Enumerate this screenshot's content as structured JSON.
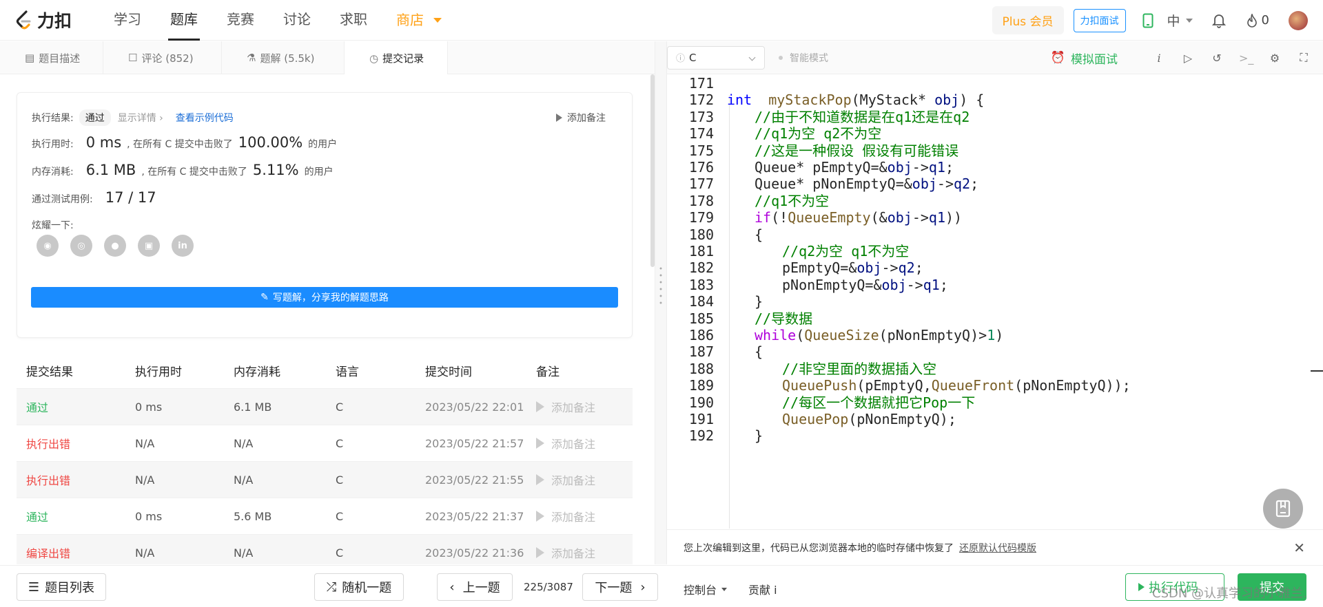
{
  "nav": {
    "brand": "力扣",
    "items": [
      "学习",
      "题库",
      "竞赛",
      "讨论",
      "求职",
      "商店"
    ],
    "active": "题库",
    "plus": "Plus 会员",
    "mock_interview": "力扣面试",
    "lang": "中",
    "points": "0"
  },
  "tabs": [
    "题目描述",
    "评论 (852)",
    "题解 (5.5k)",
    "提交记录"
  ],
  "result": {
    "label_result": "执行结果:",
    "status": "通过",
    "show_detail": "显示详情 ›",
    "view_example": "查看示例代码",
    "add_note": "添加备注",
    "label_time": "执行用时:",
    "time_value": "0 ms",
    "time_text": ", 在所有 C 提交中击败了",
    "time_pct": "100.00%",
    "users": "的用户",
    "label_mem": "内存消耗:",
    "mem_value": "6.1 MB",
    "mem_text": ", 在所有 C 提交中击败了",
    "mem_pct": "5.11%",
    "label_cases": "通过测试用例:",
    "cases": "17 / 17",
    "label_share": "炫耀一下:",
    "write_solution": "写题解，分享我的解题思路"
  },
  "table": {
    "headers": [
      "提交结果",
      "执行用时",
      "内存消耗",
      "语言",
      "提交时间",
      "备注"
    ],
    "rows": [
      {
        "status": "通过",
        "time": "0 ms",
        "mem": "6.1 MB",
        "lang": "C",
        "date": "2023/05/22 22:01",
        "note": "添加备注"
      },
      {
        "status": "执行出错",
        "time": "N/A",
        "mem": "N/A",
        "lang": "C",
        "date": "2023/05/22 21:57",
        "note": "添加备注"
      },
      {
        "status": "执行出错",
        "time": "N/A",
        "mem": "N/A",
        "lang": "C",
        "date": "2023/05/22 21:55",
        "note": "添加备注"
      },
      {
        "status": "通过",
        "time": "0 ms",
        "mem": "5.6 MB",
        "lang": "C",
        "date": "2023/05/22 21:37",
        "note": "添加备注"
      },
      {
        "status": "编译出错",
        "time": "N/A",
        "mem": "N/A",
        "lang": "C",
        "date": "2023/05/22 21:36",
        "note": "添加备注"
      }
    ]
  },
  "editor": {
    "language": "C",
    "smart_mode": "智能模式",
    "mock_interview": "模拟面试",
    "lines": [
      {
        "n": "171",
        "indent": 0,
        "parts": []
      },
      {
        "n": "172",
        "indent": 0,
        "parts": [
          [
            "kw",
            "int"
          ],
          [
            "",
            "  "
          ],
          [
            "fn",
            "myStackPop"
          ],
          [
            "",
            "(MyStack* "
          ],
          [
            "vr",
            "obj"
          ],
          [
            "",
            ") {"
          ]
        ]
      },
      {
        "n": "173",
        "indent": 1,
        "parts": [
          [
            "cm",
            "//由于不知道数据是在q1还是在q2"
          ]
        ]
      },
      {
        "n": "174",
        "indent": 1,
        "parts": [
          [
            "cm",
            "//q1为空 q2不为空"
          ]
        ]
      },
      {
        "n": "175",
        "indent": 1,
        "parts": [
          [
            "cm",
            "//这是一种假设 假设有可能错误"
          ]
        ]
      },
      {
        "n": "176",
        "indent": 1,
        "parts": [
          [
            "",
            "Queue* pEmptyQ=&"
          ],
          [
            "vr",
            "obj"
          ],
          [
            "",
            "->"
          ],
          [
            "vr",
            "q1"
          ],
          [
            "",
            ";"
          ]
        ]
      },
      {
        "n": "177",
        "indent": 1,
        "parts": [
          [
            "",
            "Queue* pNonEmptyQ=&"
          ],
          [
            "vr",
            "obj"
          ],
          [
            "",
            "->"
          ],
          [
            "vr",
            "q2"
          ],
          [
            "",
            ";"
          ]
        ]
      },
      {
        "n": "178",
        "indent": 1,
        "parts": [
          [
            "cm",
            "//q1不为空"
          ]
        ]
      },
      {
        "n": "179",
        "indent": 1,
        "parts": [
          [
            "ctrl",
            "if"
          ],
          [
            "",
            "(!"
          ],
          [
            "fn",
            "QueueEmpty"
          ],
          [
            "",
            "(&"
          ],
          [
            "vr",
            "obj"
          ],
          [
            "",
            "->"
          ],
          [
            "vr",
            "q1"
          ],
          [
            "",
            "))"
          ]
        ]
      },
      {
        "n": "180",
        "indent": 1,
        "parts": [
          [
            "",
            "{"
          ]
        ]
      },
      {
        "n": "181",
        "indent": 2,
        "parts": [
          [
            "cm",
            "//q2为空 q1不为空"
          ]
        ]
      },
      {
        "n": "182",
        "indent": 2,
        "parts": [
          [
            "",
            "pEmptyQ=&"
          ],
          [
            "vr",
            "obj"
          ],
          [
            "",
            "->"
          ],
          [
            "vr",
            "q2"
          ],
          [
            "",
            ";"
          ]
        ]
      },
      {
        "n": "183",
        "indent": 2,
        "parts": [
          [
            "",
            "pNonEmptyQ=&"
          ],
          [
            "vr",
            "obj"
          ],
          [
            "",
            "->"
          ],
          [
            "vr",
            "q1"
          ],
          [
            "",
            ";"
          ]
        ]
      },
      {
        "n": "184",
        "indent": 1,
        "parts": [
          [
            "",
            "}"
          ]
        ]
      },
      {
        "n": "185",
        "indent": 1,
        "parts": [
          [
            "cm",
            "//导数据"
          ]
        ]
      },
      {
        "n": "186",
        "indent": 1,
        "parts": [
          [
            "ctrl",
            "while"
          ],
          [
            "",
            "("
          ],
          [
            "fn",
            "QueueSize"
          ],
          [
            "",
            "(pNonEmptyQ)>"
          ],
          [
            "nm",
            "1"
          ],
          [
            "",
            ")"
          ]
        ]
      },
      {
        "n": "187",
        "indent": 1,
        "parts": [
          [
            "",
            "{"
          ]
        ]
      },
      {
        "n": "188",
        "indent": 2,
        "parts": [
          [
            "cm",
            "//非空里面的数据插入空"
          ]
        ]
      },
      {
        "n": "189",
        "indent": 2,
        "parts": [
          [
            "fn",
            "QueuePush"
          ],
          [
            "",
            "(pEmptyQ,"
          ],
          [
            "fn",
            "QueueFront"
          ],
          [
            "",
            "(pNonEmptyQ));"
          ]
        ]
      },
      {
        "n": "190",
        "indent": 2,
        "parts": [
          [
            "cm",
            "//每区一个数据就把它Pop一下"
          ]
        ]
      },
      {
        "n": "191",
        "indent": 2,
        "parts": [
          [
            "fn",
            "QueuePop"
          ],
          [
            "",
            "(pNonEmptyQ);"
          ]
        ]
      },
      {
        "n": "192",
        "indent": 1,
        "parts": [
          [
            "",
            "}"
          ]
        ]
      }
    ]
  },
  "restore": {
    "message": "您上次编辑到这里，代码已从您浏览器本地的临时存储中恢复了",
    "link": "还原默认代码模版"
  },
  "bottom": {
    "problem_list": "题目列表",
    "random": "随机一题",
    "prev": "上一题",
    "page": "225/3087",
    "next": "下一题",
    "console": "控制台",
    "contribute": "贡献 i",
    "run": "执行代码",
    "submit": "提交",
    "watermark": "CSDN @认真学习的小雅兰."
  },
  "colors": {
    "accent_green": "#2db55d",
    "error_red": "#ef4743",
    "shop_orange": "#ffa116",
    "link_blue": "#1a6dd6"
  }
}
